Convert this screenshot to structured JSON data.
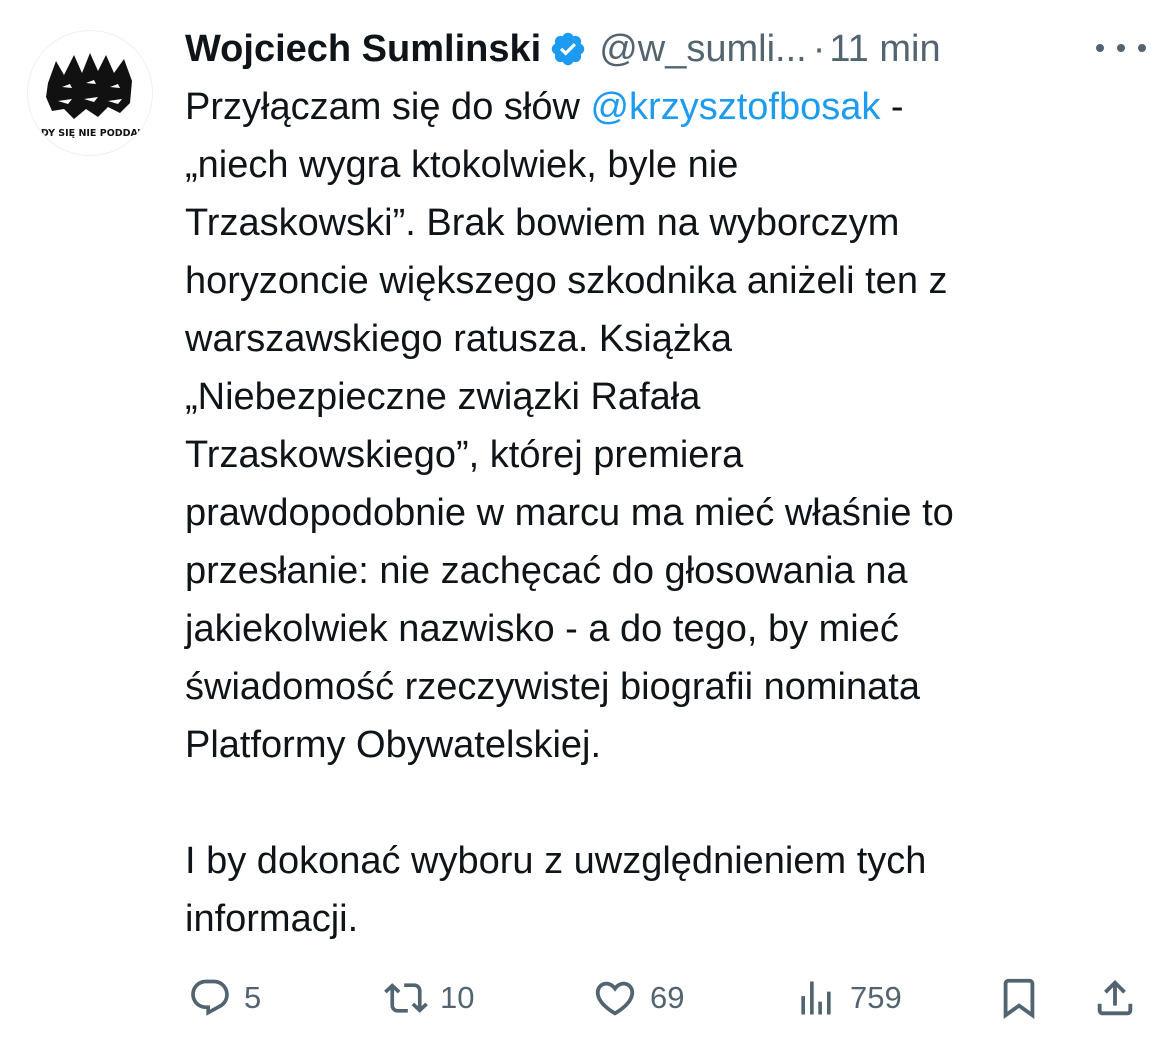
{
  "tweet": {
    "author": {
      "name": "Wojciech Sumlinski",
      "handle": "@w_sumli...",
      "avatar_text": "NIGDY SIĘ NIE PODDAWAJ",
      "verified_icon": "verified-badge-icon"
    },
    "separator": "·",
    "timestamp": "11 min",
    "more_icon": "more-horizontal-icon",
    "text": {
      "line1_prefix": "Przyłączam się do słów ",
      "mention": "@krzysztofbosak",
      "line1_suffix": " -",
      "lines": [
        "„niech wygra ktokolwiek, byle nie",
        "Trzaskowski”. Brak bowiem na wyborczym",
        "horyzoncie większego szkodnika aniżeli ten z",
        "warszawskiego ratusza. Książka",
        "„Niebezpieczne związki Rafała",
        "Trzaskowskiego”, której premiera",
        "prawdopodobnie w marcu ma mieć właśnie to",
        "przesłanie: nie zachęcać do głosowania na",
        "jakiekolwiek nazwisko - a do tego, by mieć",
        "świadomość rzeczywistej biografii nominata",
        "Platformy Obywatelskiej."
      ],
      "paragraph2": [
        "I by dokonać wyboru z uwzględnieniem tych",
        "informacji."
      ]
    },
    "actions": {
      "reply": {
        "icon": "reply-icon",
        "count": "5"
      },
      "retweet": {
        "icon": "retweet-icon",
        "count": "10"
      },
      "like": {
        "icon": "heart-icon",
        "count": "69"
      },
      "views": {
        "icon": "views-icon",
        "count": "759"
      },
      "bookmark": {
        "icon": "bookmark-icon"
      },
      "share": {
        "icon": "share-icon"
      }
    },
    "colors": {
      "text": "#0f1419",
      "secondary": "#536471",
      "link": "#1d9bf0",
      "verified": "#1d9bf0"
    }
  }
}
